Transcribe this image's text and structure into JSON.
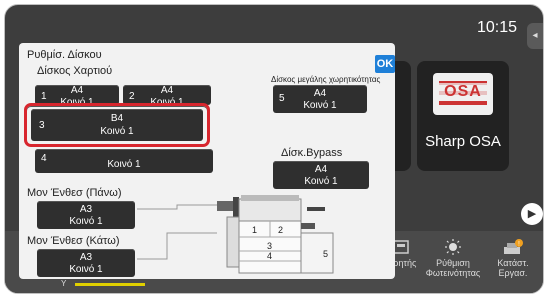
{
  "status": {
    "time": "10:15"
  },
  "home_tiles": {
    "sharp_label": "Sharp OSA",
    "sharp_logo_text": "OSA"
  },
  "bottom_bar": {
    "items": [
      {
        "label": "ετρητής"
      },
      {
        "label": "Ρύθμιση Φωτεινότητας"
      },
      {
        "label": "Κατάστ. Εργασ."
      }
    ],
    "toner_label": "Y",
    "toner_color": "#e0d000"
  },
  "dialog": {
    "title": "Ρυθμίσ. Δίσκου",
    "ok_label": "OK",
    "paper_trays_label": "Δίσκος Χαρτιού",
    "lcc_label": "Δίσκος μεγάλης χωρητικότητας",
    "bypass_label": "Δίσκ.Bypass",
    "inserter_upper_label": "Μον Ένθεσ (Πάνω)",
    "inserter_lower_label": "Μον Ένθεσ (Κάτω)",
    "trays": [
      {
        "num": "1",
        "size": "A4",
        "type": "Κοινό 1"
      },
      {
        "num": "2",
        "size": "A4",
        "type": "Κοινό 1"
      },
      {
        "num": "3",
        "size": "B4",
        "type": "Κοινό 1"
      },
      {
        "num": "4",
        "size": "",
        "type": "Κοινό 1"
      }
    ],
    "lcc": {
      "num": "5",
      "size": "A4",
      "type": "Κοινό 1"
    },
    "bypass": {
      "size": "A4",
      "type": "Κοινό 1"
    },
    "inserter_upper": {
      "size": "A3",
      "type": "Κοινό 1"
    },
    "inserter_lower": {
      "size": "A3",
      "type": "Κοινό 1"
    },
    "diagram_numbers": [
      "1",
      "2",
      "3",
      "4",
      "5"
    ],
    "colors": {
      "accent": "#1f80d8",
      "selected": "#d8262e"
    }
  }
}
